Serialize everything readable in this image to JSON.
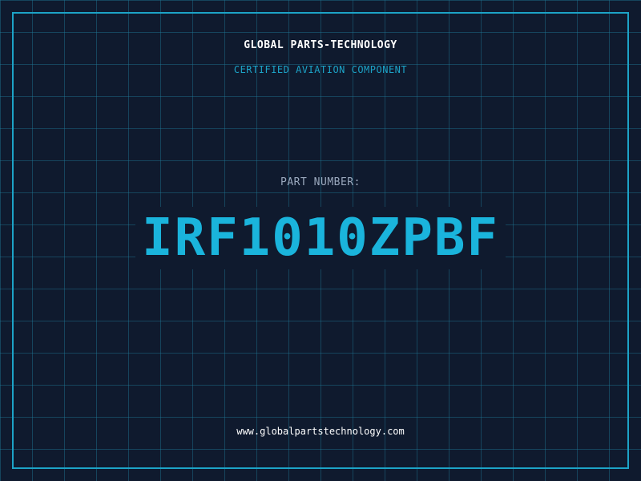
{
  "header": {
    "company": "GLOBAL PARTS-TECHNOLOGY",
    "tagline": "CERTIFIED AVIATION COMPONENT"
  },
  "main": {
    "label": "PART NUMBER:",
    "part_number": "IRF1010ZPBF"
  },
  "footer": {
    "website": "www.globalpartstechnology.com"
  },
  "colors": {
    "background": "#0f1a2e",
    "accent": "#1ab4dc",
    "grid": "#1e7896"
  }
}
